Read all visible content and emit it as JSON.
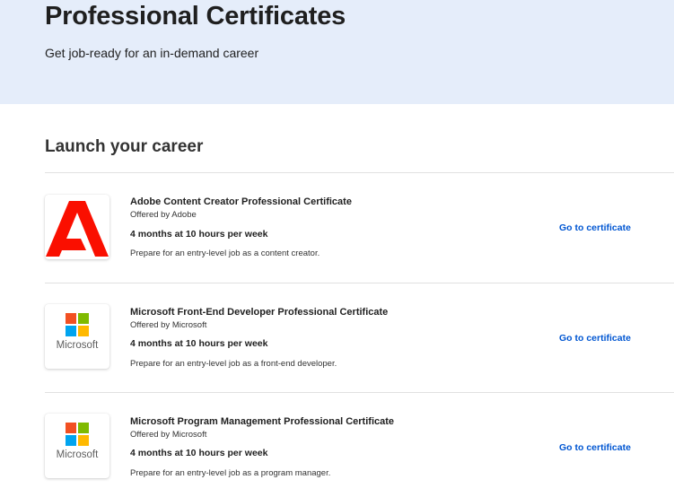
{
  "hero": {
    "title": "Professional Certificates",
    "subtitle": "Get job-ready for an in-demand career",
    "background": "#e5edfa"
  },
  "section": {
    "title": "Launch your career"
  },
  "certificates": [
    {
      "logo": "adobe-logo",
      "logo_color": "#fa0f00",
      "title": "Adobe Content Creator Professional Certificate",
      "offered_by": "Offered by Adobe",
      "duration": "4 months at 10 hours per week",
      "description": "Prepare for an entry-level job as a content creator.",
      "link": "Go to certificate"
    },
    {
      "logo": "microsoft-logo",
      "logo_text": "Microsoft",
      "title": "Microsoft Front-End Developer Professional Certificate",
      "offered_by": "Offered by Microsoft",
      "duration": "4 months at 10 hours per week",
      "description": "Prepare for an entry-level job as a front-end developer.",
      "link": "Go to certificate"
    },
    {
      "logo": "microsoft-logo",
      "logo_text": "Microsoft",
      "title": "Microsoft Program Management Professional Certificate",
      "offered_by": "Offered by Microsoft",
      "duration": "4 months at 10 hours per week",
      "description": "Prepare for an entry-level job as a program manager.",
      "link": "Go to certificate"
    }
  ],
  "colors": {
    "link": "#0056d2",
    "ms_red": "#f25022",
    "ms_green": "#7fba00",
    "ms_blue": "#00a4ef",
    "ms_yellow": "#ffb900"
  }
}
